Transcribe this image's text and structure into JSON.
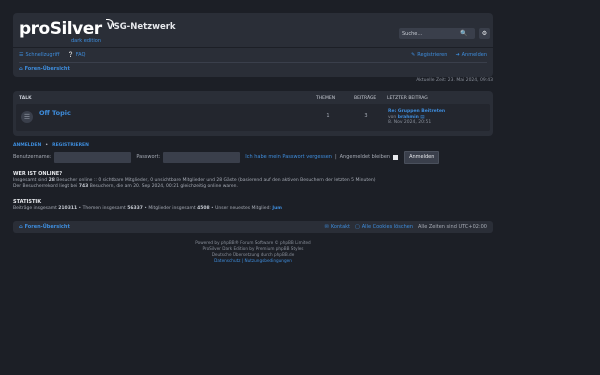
{
  "header": {
    "logo": "proSilver",
    "logo_sub": "dark edition",
    "site_name": "VSG-Netzwerk",
    "search_placeholder": "Suche…"
  },
  "nav": {
    "quicklinks": "Schnellzugriff",
    "faq": "FAQ",
    "register": "Registrieren",
    "login": "Anmelden",
    "breadcrumb": "Foren-Übersicht"
  },
  "time": "Aktuelle Zeit: 23. Mai 2024, 09:43",
  "forums": {
    "headers": {
      "talk": "Talk",
      "topics": "Themen",
      "posts": "Beiträge",
      "last_post": "Letzter Beitrag"
    },
    "rows": [
      {
        "title": "Off Topic",
        "topics": "1",
        "posts": "3",
        "last_title": "Re: Gruppen Beitreten",
        "last_by_prefix": "von",
        "last_author": "brahmin",
        "last_date": "8. Nov 2024, 20:51"
      }
    ]
  },
  "login": {
    "title_login": "Anmelden",
    "title_register": "Registrieren",
    "username_label": "Benutzername:",
    "password_label": "Passwort:",
    "forgot": "Ich habe mein Passwort vergessen",
    "remember": "Angemeldet bleiben",
    "submit": "Anmelden"
  },
  "online": {
    "title": "Wer ist online?",
    "line1_prefix": "Insgesamt sind",
    "line1_count": "28",
    "line1_rest": "Besucher online :: 0 sichtbare Mitglieder, 0 unsichtbare Mitglieder und 28 Gäste (basierend auf den aktiven Besuchern der letzten 5 Minuten)",
    "line2_prefix": "Der Besucherrekord liegt bei",
    "line2_count": "743",
    "line2_rest": "Besuchern, die am 20. Sep 2024, 00:21 gleichzeitig online waren."
  },
  "stats": {
    "title": "Statistik",
    "posts_label": "Beiträge insgesamt",
    "posts": "210311",
    "topics_label": "• Themen insgesamt",
    "topics": "56337",
    "members_label": "• Mitglieder insgesamt",
    "members": "4508",
    "newest_label": "• Unser neuestes Mitglied:",
    "newest": "Jum"
  },
  "footer": {
    "breadcrumb": "Foren-Übersicht",
    "contact": "Kontakt",
    "delete_cookies": "Alle Cookies löschen",
    "timezone": "Alle Zeiten sind UTC+02:00",
    "credits": [
      "Powered by phpBB® Forum Software © phpBB Limited",
      "ProSilver Dark Edition by Premium phpBB Styles",
      "Deutsche Übersetzung durch phpBB.de",
      "Datenschutz | Nutzungsbedingungen"
    ]
  }
}
